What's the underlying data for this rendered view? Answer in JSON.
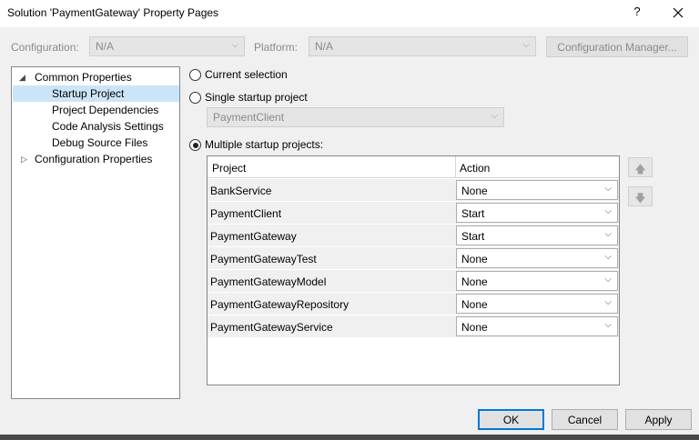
{
  "window": {
    "title": "Solution 'PaymentGateway' Property Pages",
    "help_label": "?",
    "close_icon": "close-icon"
  },
  "config_bar": {
    "configuration_label": "Configuration:",
    "configuration_value": "N/A",
    "platform_label": "Platform:",
    "platform_value": "N/A",
    "manager_label": "Configuration Manager..."
  },
  "tree": {
    "expanded_arrow": "◢",
    "collapsed_arrow": "▷",
    "items": [
      {
        "label": "Common Properties"
      },
      {
        "label": "Startup Project"
      },
      {
        "label": "Project Dependencies"
      },
      {
        "label": "Code Analysis Settings"
      },
      {
        "label": "Debug Source Files"
      },
      {
        "label": "Configuration Properties"
      }
    ]
  },
  "startup": {
    "current_selection_label": "Current selection",
    "single_label": "Single startup project",
    "single_value": "PaymentClient",
    "multiple_label": "Multiple startup projects:",
    "selected_option": "multiple"
  },
  "grid": {
    "col_project": "Project",
    "col_action": "Action",
    "rows": [
      {
        "project": "BankService",
        "action": "None"
      },
      {
        "project": "PaymentClient",
        "action": "Start"
      },
      {
        "project": "PaymentGateway",
        "action": "Start"
      },
      {
        "project": "PaymentGatewayTest",
        "action": "None"
      },
      {
        "project": "PaymentGatewayModel",
        "action": "None"
      },
      {
        "project": "PaymentGatewayRepository",
        "action": "None"
      },
      {
        "project": "PaymentGatewayService",
        "action": "None"
      }
    ]
  },
  "move": {
    "up_icon": "arrow-up-icon",
    "down_icon": "arrow-down-icon",
    "up_glyph": "🡅",
    "down_glyph": "🡇"
  },
  "buttons": {
    "ok": "OK",
    "cancel": "Cancel",
    "apply": "Apply"
  },
  "colors": {
    "accent": "#0078d7",
    "selection": "#cce4f7"
  }
}
